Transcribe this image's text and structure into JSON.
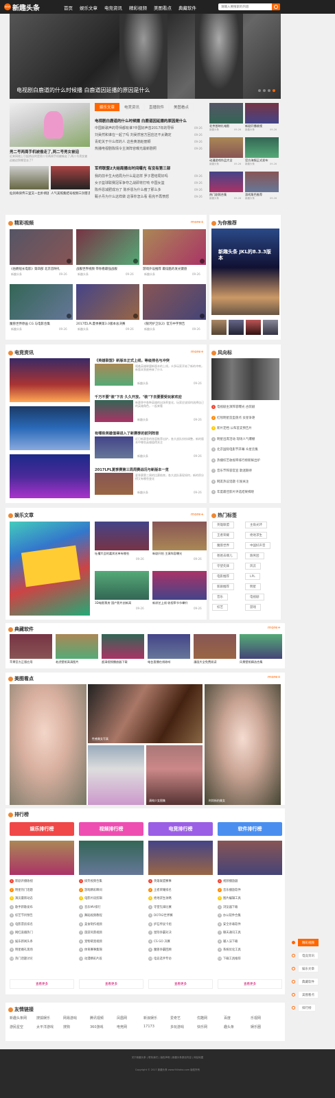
{
  "header": {
    "logo_badge": "NEW",
    "logo_text": "新趣头条",
    "logo_sub": "www.94haha.com",
    "nav": [
      "首页",
      "娱乐文章",
      "电竞资讯",
      "精彩视频",
      "美图看点",
      "典藏软件"
    ],
    "search_placeholder": "请输入要搜索的内容"
  },
  "hero": {
    "caption": "电视剧白鹿道的什么时候播 白鹿道因延播的原因是什么",
    "slides": 4,
    "active": 3
  },
  "top": {
    "left_main_title": "男二号两周手机被偷走了,两二号男女被迫",
    "left_main_desc": "近来网络上引起热议的是男二号两周手机被偷走了,两二号男女被迫被迫到哪里去了?",
    "left_small": [
      {
        "title": "仙剑奇侠传三里又一出扑朔迷离"
      },
      {
        "title": "人气美照集结号视频三剑客走进了"
      }
    ],
    "tabs": [
      "娱乐文章",
      "电竞资讯",
      "直播软件",
      "美图看点"
    ],
    "active_tab": 0,
    "headline1": "电视剧白鹿道的什么时候播 白鹿道因延播的原因是什么",
    "list1": [
      {
        "title": "中国新歌声的导师都有谁?中国好声音2017年的导师",
        "date": "09-26"
      },
      {
        "title": "刘昊然和谁在一起了吗 刘昊然官方回应还不太确定",
        "date": "09-26"
      },
      {
        "title": "青蛇关于什么样的人 这些黄渤赵丽颖",
        "date": "09-26"
      },
      {
        "title": "热播电视剧陈情令主演阵容曝光最新剧照",
        "date": "09-26"
      }
    ],
    "headline2": "军师联盟2大结局播出时间曝光 有没有第三部",
    "list2": [
      {
        "title": "我的前半生大结局为什么是这样 罗子君结局好吗",
        "date": "09-26"
      },
      {
        "title": "女子篮球联赛冠军争夺之战即将打响 中国女篮",
        "date": "09-26"
      },
      {
        "title": "陈乔恩减肥成功了 陈乔恩为什么瘦了那么多",
        "date": "09-26"
      },
      {
        "title": "甄子丹为什么这样做 这事你怎么看 看完不再愤怒",
        "date": "09-26"
      }
    ],
    "right_grid": [
      {
        "title": "北京首映礼电影",
        "author": "新趣头条",
        "date": "09-26"
      },
      {
        "title": "新剧开播收视",
        "author": "新趣头条",
        "date": "09-26"
      },
      {
        "title": "动漫游戏作品大全",
        "author": "新趣头条",
        "date": "09-26"
      },
      {
        "title": "官方海报正式发布",
        "author": "新趣头条",
        "date": "09-26"
      },
      {
        "title": "热门剧照合集",
        "author": "新趣头条",
        "date": "09-26"
      },
      {
        "title": "游戏角色推荐",
        "author": "新趣头条",
        "date": "09-26"
      }
    ]
  },
  "videos": {
    "title": "精彩视频",
    "more": "more+",
    "items": [
      {
        "title": "《伯爵船长电影》第四部 北京首映礼",
        "author": "新趣头条",
        "date": "09-26"
      },
      {
        "title": "战舰世界视频 带你看最强战舰",
        "author": "新趣头条",
        "date": "09-26"
      },
      {
        "title": "游戏外设推荐 最炫酷的发光键盘",
        "author": "新趣头条",
        "date": "09-26"
      },
      {
        "title": "魔兽世界原画 CG 与电影合集",
        "author": "新趣头条",
        "date": "09-26"
      },
      {
        "title": "2017年LPL夏季赛第3.0版本总决赛",
        "author": "新趣头条",
        "date": "09-26"
      },
      {
        "title": "《银河护卫队2》官方中字预告",
        "author": "新趣头条",
        "date": "09-26"
      }
    ]
  },
  "recommend": {
    "title": "为你推荐",
    "banner_text": "新趣头条 JKL的8.3.3版本"
  },
  "esports": {
    "title": "电竞资讯",
    "more": "more+",
    "articles": [
      {
        "title": "《英雄联盟》新版本正式上线，等级排名与冲突",
        "desc": "随着英雄联盟新版本的上线，众多玩家开始了新的冲刺，新版本到底带来了什么",
        "author": "新趣头条",
        "date": "09-26"
      },
      {
        "title": "千万不要\"装\"下去 久久开放，\"装\"下去要要受玩家欢迎",
        "desc": "新赛季中各种英雄的出场率变化，玩家应该如何选择自己的英雄角色，一起来看",
        "author": "新趣头条",
        "date": "09-26"
      },
      {
        "title": "有哪些英雄值得进入了新赛季的前列阵容",
        "desc": "近日新赛季的阵容推荐出炉，各大战队纷纷调整，新的版本中哪些英雄值得关注",
        "author": "新趣头条",
        "date": "09-26"
      },
      {
        "title": "2017LPL夏季赛第三周周赛战况与新版本一览",
        "desc": "夏季赛第三周的比赛结束，各大战队表现如何，新的积分榜又有哪些变化",
        "author": "新趣头条",
        "date": "09-26"
      }
    ]
  },
  "fengyun": {
    "title": "风向标",
    "items": [
      "电视剧主演阵容曝光 古装剧",
      "红毯明星造型盘点 女星争艳",
      "新片定档 公布首支预告片",
      "明星出席活动 现场人气爆棚",
      "北京国际电影节开幕 众星云集",
      "热播综艺收视率排行榜新鲜出炉",
      "音乐节阵容官宣 歌迷期待",
      "网友热议话题 引发关注",
      "年度最佳影片评选结果揭晓"
    ]
  },
  "yule": {
    "title": "娱乐文章",
    "more": "more+",
    "items": [
      {
        "title": "吐槽大会的嘉宾名单有哪些",
        "date": "09-26"
      },
      {
        "title": "新剧开拍 主演阵容曝光",
        "date": "09-26"
      },
      {
        "title": "3D电影票房 国产影片创新高",
        "date": "09-26"
      },
      {
        "title": "新综艺上线 收视率节节攀升",
        "date": "09-26"
      }
    ]
  },
  "hot_tags": {
    "title": "热门标签",
    "tags": [
      "英雄联盟",
      "主角光环",
      "王者荣耀",
      "绝地求生",
      "魔兽世界",
      "中国好声音",
      "爸爸去哪儿",
      "跑男团",
      "守望先锋",
      "风云",
      "电影推荐",
      "LPL",
      "新剧推荐",
      "明星",
      "音乐",
      "电视剧",
      "综艺",
      "游戏"
    ]
  },
  "software": {
    "title": "典藏软件",
    "more": "more+",
    "items": [
      {
        "title": "苹果官方正版应用"
      },
      {
        "title": "老虎壁纸高清图片"
      },
      {
        "title": "超清视频播放器下载"
      },
      {
        "title": "电台直播在线收听"
      },
      {
        "title": "漫画大全免费阅读"
      },
      {
        "title": "风景壁纸精选合集"
      }
    ]
  },
  "meitu": {
    "title": "美图看点",
    "more": "more+",
    "captions": [
      "性感美女写真",
      "清纯少女图集",
      "时尚街拍美女"
    ]
  },
  "ranking": {
    "title": "排行榜",
    "columns": [
      {
        "label": "娱乐排行榜",
        "color": "#f04848",
        "items": [
          "新剧开播收视",
          "明星热门话题",
          "演员最新动态",
          "歌手新歌发布",
          "综艺节目预告",
          "电影票房排名",
          "网红直播热门",
          "娱乐新闻头条",
          "明星婚礼现场",
          "热门话题讨论"
        ]
      },
      {
        "label": "视频排行榜",
        "color": "#ee4eb2",
        "items": [
          "搞笑视频合集",
          "游戏精彩瞬间",
          "电影片段剪辑",
          "音乐MV排行",
          "舞蹈视频教程",
          "美食制作视频",
          "旅游风景视频",
          "宠物萌宠视频",
          "体育赛事集锦",
          "动漫精彩片段"
        ]
      },
      {
        "label": "电竞排行榜",
        "color": "#9b5fe6",
        "items": [
          "英雄联盟赛事",
          "王者荣耀排名",
          "绝地求生攻略",
          "守望先锋比赛",
          "DOTA2世界赛",
          "炉石传说卡组",
          "星际争霸对决",
          "CS GO 决赛",
          "魔兽争霸回顾",
          "电竞选手专访"
        ]
      },
      {
        "label": "软件排行榜",
        "color": "#4a8ff0",
        "items": [
          "视频播放器",
          "音乐播放软件",
          "图片编辑工具",
          "浏览器下载",
          "办公软件合集",
          "安全杀毒软件",
          "聊天通讯工具",
          "输入法下载",
          "系统优化工具",
          "下载工具推荐"
        ]
      }
    ],
    "all_btn": "查看更多"
  },
  "side_nav": [
    "精彩视频",
    "电竞资讯",
    "娱乐文章",
    "典藏软件",
    "美图看点",
    "排行榜"
  ],
  "side_active": 0,
  "links": {
    "title": "友情链接",
    "items": [
      "新趣头条网",
      "搜狐娱乐",
      "网易游戏",
      "腾讯视频",
      "凤凰网",
      "新浪娱乐",
      "爱奇艺",
      "优酷网",
      "百度",
      "乐视网",
      "游民星空",
      "太平洋游戏",
      "搜狗",
      "360游戏",
      "电竞网",
      "17173",
      "多玩游戏",
      "快乐网",
      "趣头条",
      "娱乐圈"
    ]
  },
  "footer": {
    "line1": "关于新趣头条 | 联系我们 | 版权声明 | 新趣头条原创内容 | 网站地图",
    "line2": "Copyright © 2017 新趣头条 www.94haha.com 版权所有"
  }
}
